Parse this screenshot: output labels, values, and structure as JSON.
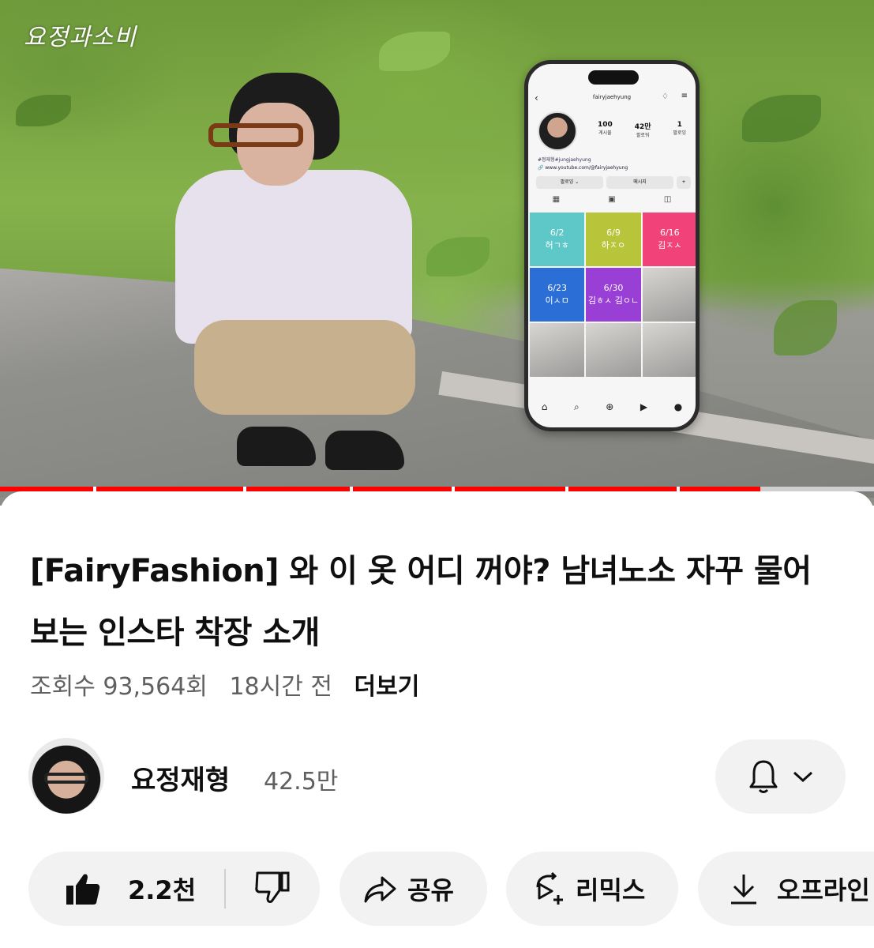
{
  "video": {
    "watermark": "요정과소비",
    "progress_fraction": 0.87
  },
  "phone": {
    "username": "fairyjaehyung",
    "stats": [
      {
        "num": "100",
        "label": "게시물"
      },
      {
        "num": "42만",
        "label": "팔로워"
      },
      {
        "num": "1",
        "label": "팔로잉"
      }
    ],
    "tags": "#정재형#jungjaehyung",
    "link": "www.youtube.com/@fairyjaehyung",
    "follow_btn": "팔로잉 ⌄",
    "message_btn": "메시지",
    "tiles": [
      {
        "date": "6/2",
        "name": "허ㄱㅎ",
        "color": "#5ec8c8"
      },
      {
        "date": "6/9",
        "name": "하ㅈㅇ",
        "color": "#b8c53a"
      },
      {
        "date": "6/16",
        "name": "김ㅈㅅ",
        "color": "#f2427a"
      },
      {
        "date": "6/23",
        "name": "이ㅅㅁ",
        "color": "#2b6fd6"
      },
      {
        "date": "6/30",
        "name": "김ㅎㅅ 김ㅇㄴ",
        "color": "#9a3fd6"
      }
    ]
  },
  "info": {
    "title": "[FairyFashion] 와 이 옷 어디 꺼야? 남녀노소 자꾸 물어보는 인스타 착장 소개",
    "views": "조회수 93,564회",
    "time_ago": "18시간 전",
    "more": "더보기"
  },
  "channel": {
    "name": "요정재형",
    "subscribers": "42.5만"
  },
  "actions": {
    "likes": "2.2천",
    "share": "공유",
    "remix": "리믹스",
    "offline": "오프라인"
  },
  "icons": [
    "thumbs-up-icon",
    "thumbs-down-icon",
    "share-icon",
    "remix-icon",
    "download-icon",
    "bell-icon",
    "chevron-down-icon"
  ]
}
